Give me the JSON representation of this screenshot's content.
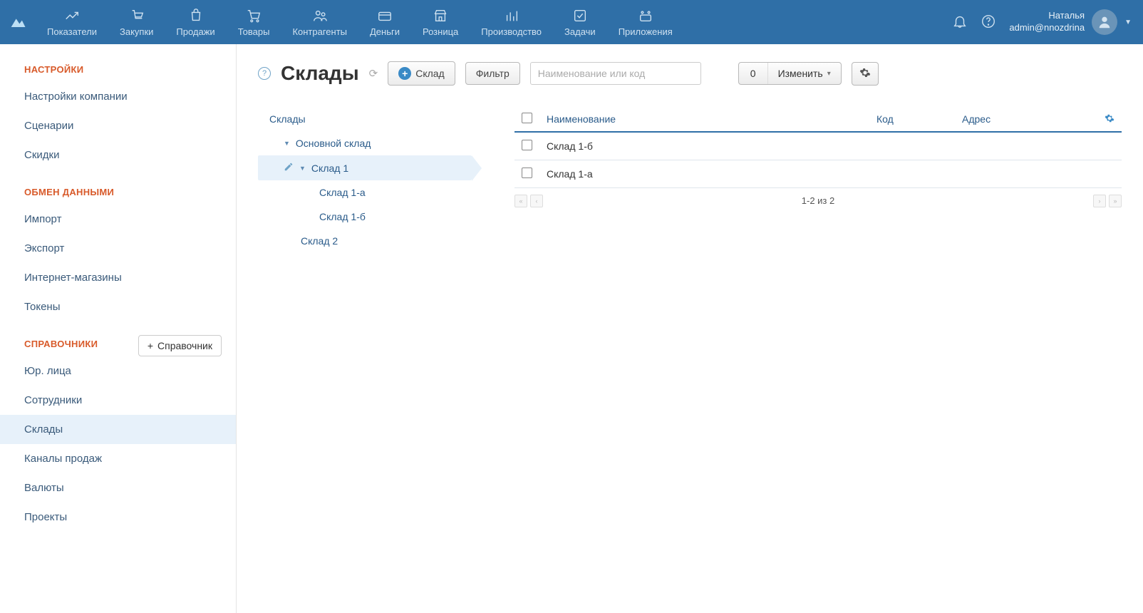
{
  "nav": {
    "items": [
      {
        "label": "Показатели"
      },
      {
        "label": "Закупки"
      },
      {
        "label": "Продажи"
      },
      {
        "label": "Товары"
      },
      {
        "label": "Контрагенты"
      },
      {
        "label": "Деньги"
      },
      {
        "label": "Розница"
      },
      {
        "label": "Производство"
      },
      {
        "label": "Задачи"
      },
      {
        "label": "Приложения"
      }
    ],
    "user_name": "Наталья",
    "user_login": "admin@nnozdrina"
  },
  "sidebar": {
    "g1_title": "НАСТРОЙКИ",
    "g1": [
      "Настройки компании",
      "Сценарии",
      "Скидки"
    ],
    "g2_title": "ОБМЕН ДАННЫМИ",
    "g2": [
      "Импорт",
      "Экспорт",
      "Интернет-магазины",
      "Токены"
    ],
    "g3_title": "СПРАВОЧНИКИ",
    "g3_add": "Справочник",
    "g3": [
      "Юр. лица",
      "Сотрудники",
      "Склады",
      "Каналы продаж",
      "Валюты",
      "Проекты"
    ]
  },
  "page": {
    "title": "Склады",
    "add_btn": "Склад",
    "filter_btn": "Фильтр",
    "search_placeholder": "Наименование или код",
    "change_count": "0",
    "change_label": "Изменить"
  },
  "tree": {
    "root": "Склады",
    "n1": "Основной склад",
    "n2": "Склад 1",
    "n3": "Склад 1-а",
    "n4": "Склад 1-б",
    "n5": "Склад 2"
  },
  "table": {
    "col_name": "Наименование",
    "col_code": "Код",
    "col_addr": "Адрес",
    "rows": [
      {
        "name": "Склад 1-б"
      },
      {
        "name": "Склад 1-а"
      }
    ],
    "pager": "1-2 из 2"
  }
}
